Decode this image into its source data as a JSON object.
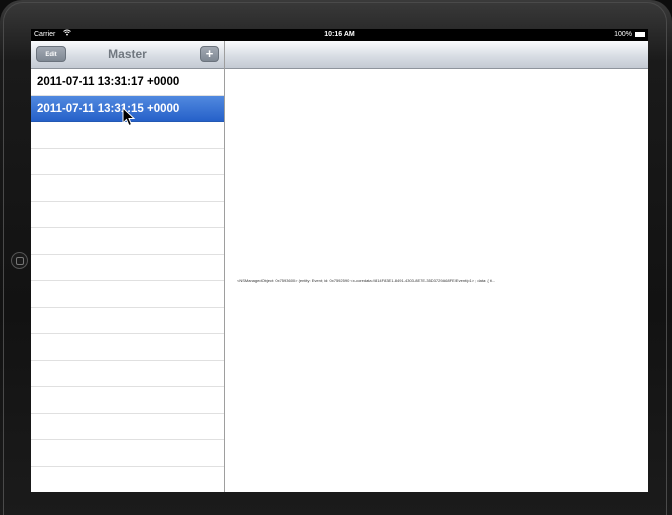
{
  "status_bar": {
    "carrier": "Carrier",
    "wifi_icon": "wifi-icon",
    "time": "10:16 AM",
    "battery_percent": "100%",
    "battery_icon": "battery-icon"
  },
  "master": {
    "title": "Master",
    "edit_label": "Edit",
    "add_label": "+",
    "rows": [
      "2011-07-11 13:31:17 +0000",
      "2011-07-11 13:31:15 +0000"
    ],
    "selected_index": 1
  },
  "detail": {
    "description": "<NSManagedObject: 0x7593600> (entity: Event; id: 0x7592590 <x-coredata://814F83E1-8491-4303-8E7E-35D3729A68FE/Event/p1> ; data: {    ti..."
  },
  "colors": {
    "selection": "#2661c9",
    "navbar": "#d8dde4",
    "bezel": "#121212"
  }
}
